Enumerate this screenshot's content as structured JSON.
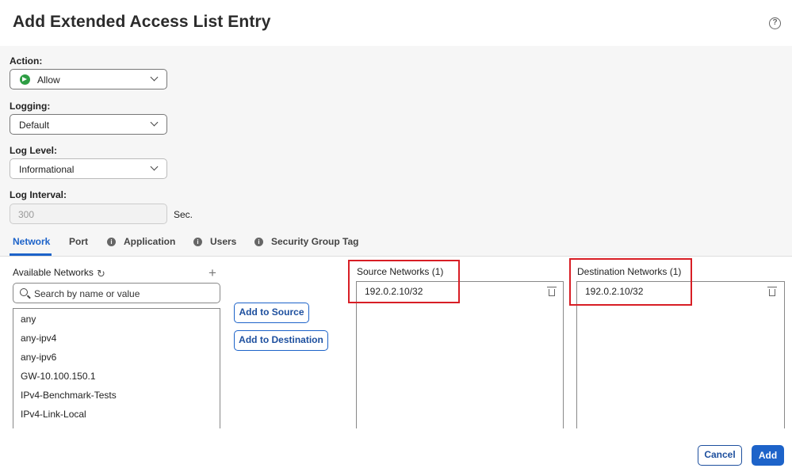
{
  "dialog": {
    "title": "Add Extended Access List Entry",
    "help_icon": "?"
  },
  "action": {
    "label": "Action:",
    "value": "Allow",
    "icon": "allow-arrow-icon"
  },
  "logging": {
    "label": "Logging:",
    "value": "Default"
  },
  "log_level": {
    "label": "Log Level:",
    "value": "Informational"
  },
  "log_interval": {
    "label": "Log Interval:",
    "placeholder": "300",
    "unit": "Sec."
  },
  "tabs": [
    {
      "label": "Network",
      "active": true
    },
    {
      "label": "Port"
    },
    {
      "label": "Application"
    },
    {
      "label": "Users"
    },
    {
      "label": "Security Group Tag"
    }
  ],
  "available": {
    "title": "Available Networks",
    "search_placeholder": "Search by name or value",
    "items": [
      "any",
      "any-ipv4",
      "any-ipv6",
      "GW-10.100.150.1",
      "IPv4-Benchmark-Tests",
      "IPv4-Link-Local"
    ]
  },
  "buttons": {
    "add_to_source": "Add to Source",
    "add_to_destination": "Add to Destination",
    "cancel": "Cancel",
    "add": "Add"
  },
  "source": {
    "title": "Source Networks",
    "count": "(1)",
    "items": [
      "192.0.2.10/32"
    ]
  },
  "destination": {
    "title": "Destination Networks",
    "count": "(1)",
    "items": [
      "192.0.2.10/32"
    ]
  },
  "colors": {
    "accent": "#1d63c9",
    "highlight": "#d81e25",
    "allow": "#2e9e44"
  }
}
